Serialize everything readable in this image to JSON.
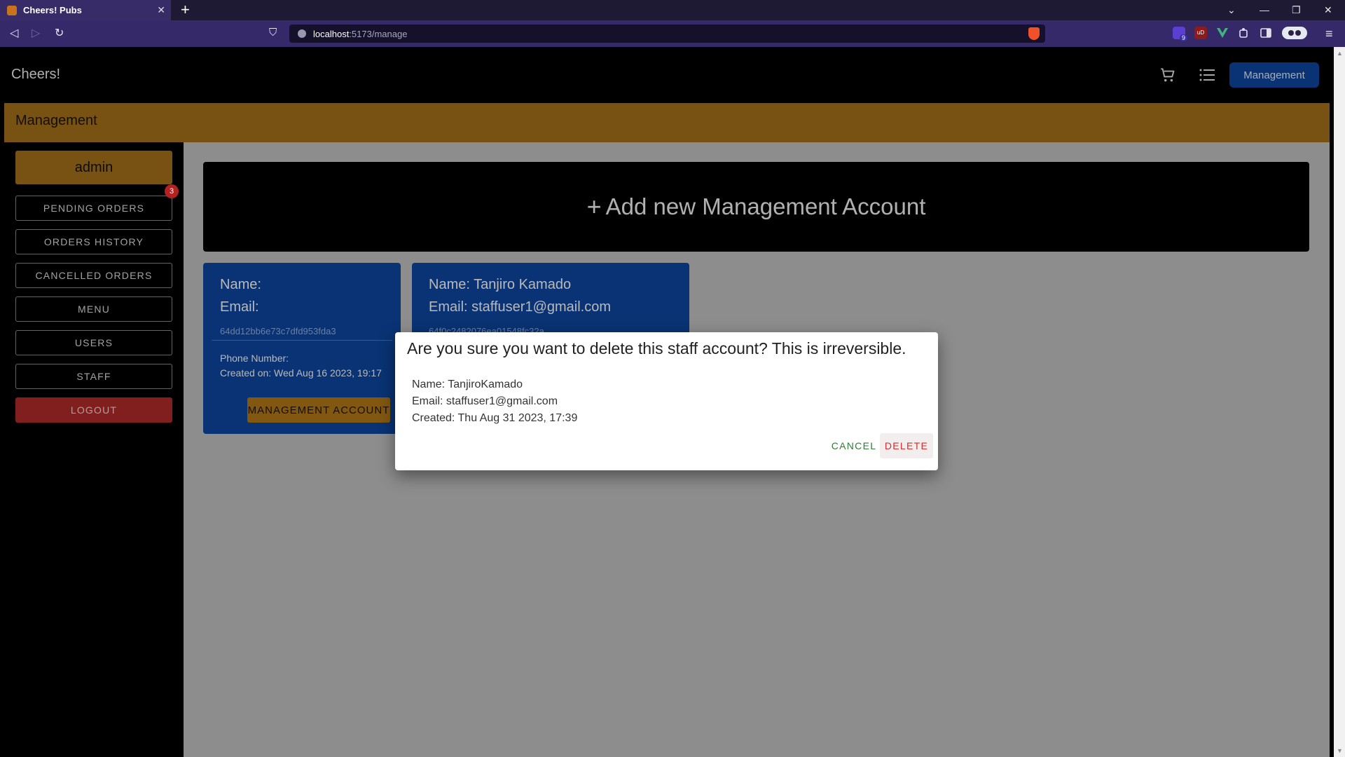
{
  "browser": {
    "tab_title": "Cheers! Pubs",
    "tab_close": "✕",
    "new_tab": "+",
    "url_host": "localhost",
    "url_path": ":5173/manage",
    "extension_badge": "9",
    "extension_label": "uD",
    "window_minimize": "—",
    "window_restore": "❐",
    "window_close": "✕",
    "back_glyph": "◁",
    "forward_glyph": "▷",
    "reload_glyph": "↻",
    "bookmark_glyph": "⛉",
    "menu_glyph": "≡",
    "tablist_glyph": "⌄"
  },
  "header": {
    "brand": "Cheers!",
    "management_button": "Management"
  },
  "section": {
    "title": "Management"
  },
  "sidebar": {
    "admin_label": "admin",
    "pending_badge": "3",
    "items": [
      {
        "label": "PENDING ORDERS"
      },
      {
        "label": "ORDERS HISTORY"
      },
      {
        "label": "CANCELLED ORDERS"
      },
      {
        "label": "MENU"
      },
      {
        "label": "USERS"
      },
      {
        "label": "STAFF"
      }
    ],
    "logout_label": "LOGOUT"
  },
  "main": {
    "add_plus": "+",
    "add_button_label": "Add new Management Account",
    "cards": [
      {
        "name_line": "Name:",
        "email_line": "Email:",
        "id": "64dd12bb6e73c7dfd953fda3",
        "phone_line": "Phone Number:",
        "created_line": "Created on: Wed Aug 16 2023, 19:17",
        "role_button": "MANAGEMENT ACCOUNT"
      },
      {
        "name_line": "Name: Tanjiro Kamado",
        "email_line": "Email: staffuser1@gmail.com",
        "id": "64f0c2482076ea01548fc32a"
      }
    ]
  },
  "dialog": {
    "title": "Are you sure you want to delete this staff account? This is irreversible.",
    "name_line": "Name: TanjiroKamado",
    "email_line": "Email: staffuser1@gmail.com",
    "created_line": "Created: Thu Aug 31 2023, 17:39",
    "cancel_label": "CANCEL",
    "delete_label": "DELETE"
  },
  "colors": {
    "browser_bar": "#35296a",
    "accent_gold": "#a7721a",
    "card_blue": "#0d47a1",
    "logout_red": "#b32a2a",
    "cancel_green": "#2e7d32",
    "delete_red": "#d32f2f"
  },
  "icons": {
    "cart": "shopping-cart-icon",
    "list": "list-icon",
    "info": "info-icon",
    "brave": "brave-lion-icon"
  }
}
